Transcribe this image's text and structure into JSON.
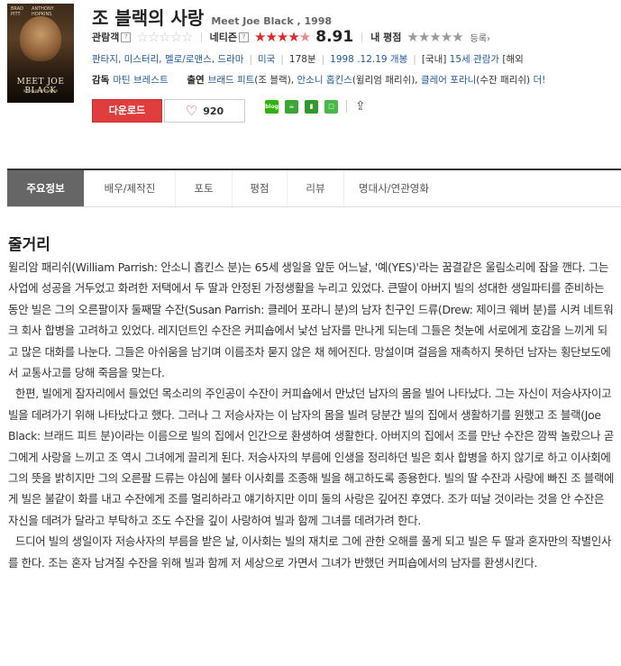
{
  "poster": {
    "top_left": "BRAD PITT",
    "top_right": "ANTHONY HOPKINS",
    "title": "MEET JOE BLACK",
    "subtitle": "a Universal release"
  },
  "title": {
    "korean": "조 블랙의 사랑",
    "english": "Meet Joe Black , 1998"
  },
  "ratings": {
    "audience_label": "관람객",
    "audience_stars": "☆☆☆☆☆",
    "netizen_label": "네티즌",
    "netizen_stars_on": "★★★★",
    "netizen_stars_half": "★",
    "netizen_score": "8.91",
    "my_label": "내 평점",
    "my_stars": "★★★★★",
    "register": "등록›"
  },
  "meta": {
    "genres": "판타지, 미스터리, 멜로/로맨스, 드라마",
    "country": "미국",
    "runtime": "178분",
    "release": "1998 .12.19 개봉",
    "rating_prefix": "[국내]",
    "rating": "15세 관람가",
    "extra": "[해외"
  },
  "credits": {
    "director_label": "감독",
    "director": "마틴 브레스트",
    "cast_label": "출연",
    "cast1": "브래드 피트",
    "cast1_role": "(조 블랙),",
    "cast2": "안소니 홉킨스",
    "cast2_role": "(윌리엄 패리쉬),",
    "cast3": "클레어 포라니",
    "cast3_role": "(수잔 패리쉬)",
    "more": "더!"
  },
  "actions": {
    "download": "다운로드",
    "like_count": "920"
  },
  "share": {
    "blog": "blog"
  },
  "tabs": [
    "주요정보",
    "배우/제작진",
    "포토",
    "평점",
    "리뷰",
    "명대사/연관영화"
  ],
  "section": {
    "title": "줄거리"
  },
  "plot": [
    "윌리암 패리쉬(William Parrish: 안소니 홉킨스 분)는 65세 생일을 앞둔 어느날, '예(YES)'라는 꿈결같은 울림소리에 잠을 깬다. 그는 사업에 성공을 거두었고 화려한 저택에서 두 딸과 안정된 가정생활을 누리고 있었다. 큰딸이 아버지 빌의 성대한 생일파티를 준비하는 동안 빌은 그의 오른팔이자 둘째딸 수잔(Susan Parrish: 클레어 포라니 분)의 남자 친구인 드류(Drew: 제이크 웨버 분)를 시켜 네트워크 회사 합병을 고려하고 있었다. 레지던트인 수잔은 커피숍에서 낯선 남자를 만나게 되는데 그들은 첫눈에 서로에게 호감을 느끼게 되고 많은 대화를 나눈다. 그들은 아쉬움을 남기며 이름조차 묻지 않은 채 헤어진다. 망설이며 걸음을 재촉하지 못하던 남자는 횡단보도에서 교통사고를 당해 죽음을 맞는다.",
    "한편, 빌에게 잠자리에서 들었던 목소리의 주인공이 수잔이 커피숍에서 만났던 남자의 몸을 빌어 나타났다. 그는 자신이 저승사자이고 빌을 데려가기 위해 나타났다고 했다. 그러나 그 저승사자는 이 남자의 몸을 빌려 당분간 빌의 집에서 생활하기를 원했고 조 블랙(Joe Black: 브래드 피트 분)이라는 이름으로 빌의 집에서 인간으로 환생하여 생활한다. 아버지의 집에서 조를 만난 수잔은 깜짝 놀랐으나 곧 그에게 사랑을 느끼고 조 역시 그녀에게 끌리게 된다. 저승사자의 부름에 인생을 정리하던 빌은 회사 합병을 하지 않기로 하고 이사회에 그의 뜻을 밝히지만 그의 오른팔 드류는 야심에 불타 이사회를 조종해 빌을 해고하도록 종용한다. 빌의 딸 수잔과 사랑에 빠진 조 블랙에게 빌은 불같이 화를 내고 수잔에게 조를 멀리하라고 얘기하지만 이미 둘의 사랑은 깊어진 후였다. 조가 떠날 것이라는 것을 안 수잔은 자신을 데려가 달라고 부탁하고 조도 수잔을 깊이 사랑하여 빌과 함께 그녀를 데려가려 한다.",
    "드디어 빌의 생일이자 저승사자의 부름을 받은 날, 이사회는 빌의 재치로 그에 관한 오해를 풀게 되고 빌은 두 딸과 혼자만의 작별인사를 한다. 조는 혼자 남겨질 수잔을 위해 빌과 함께 저 세상으로 가면서 그녀가 반했던 커피숍에서의 남자를 환생시킨다."
  ]
}
